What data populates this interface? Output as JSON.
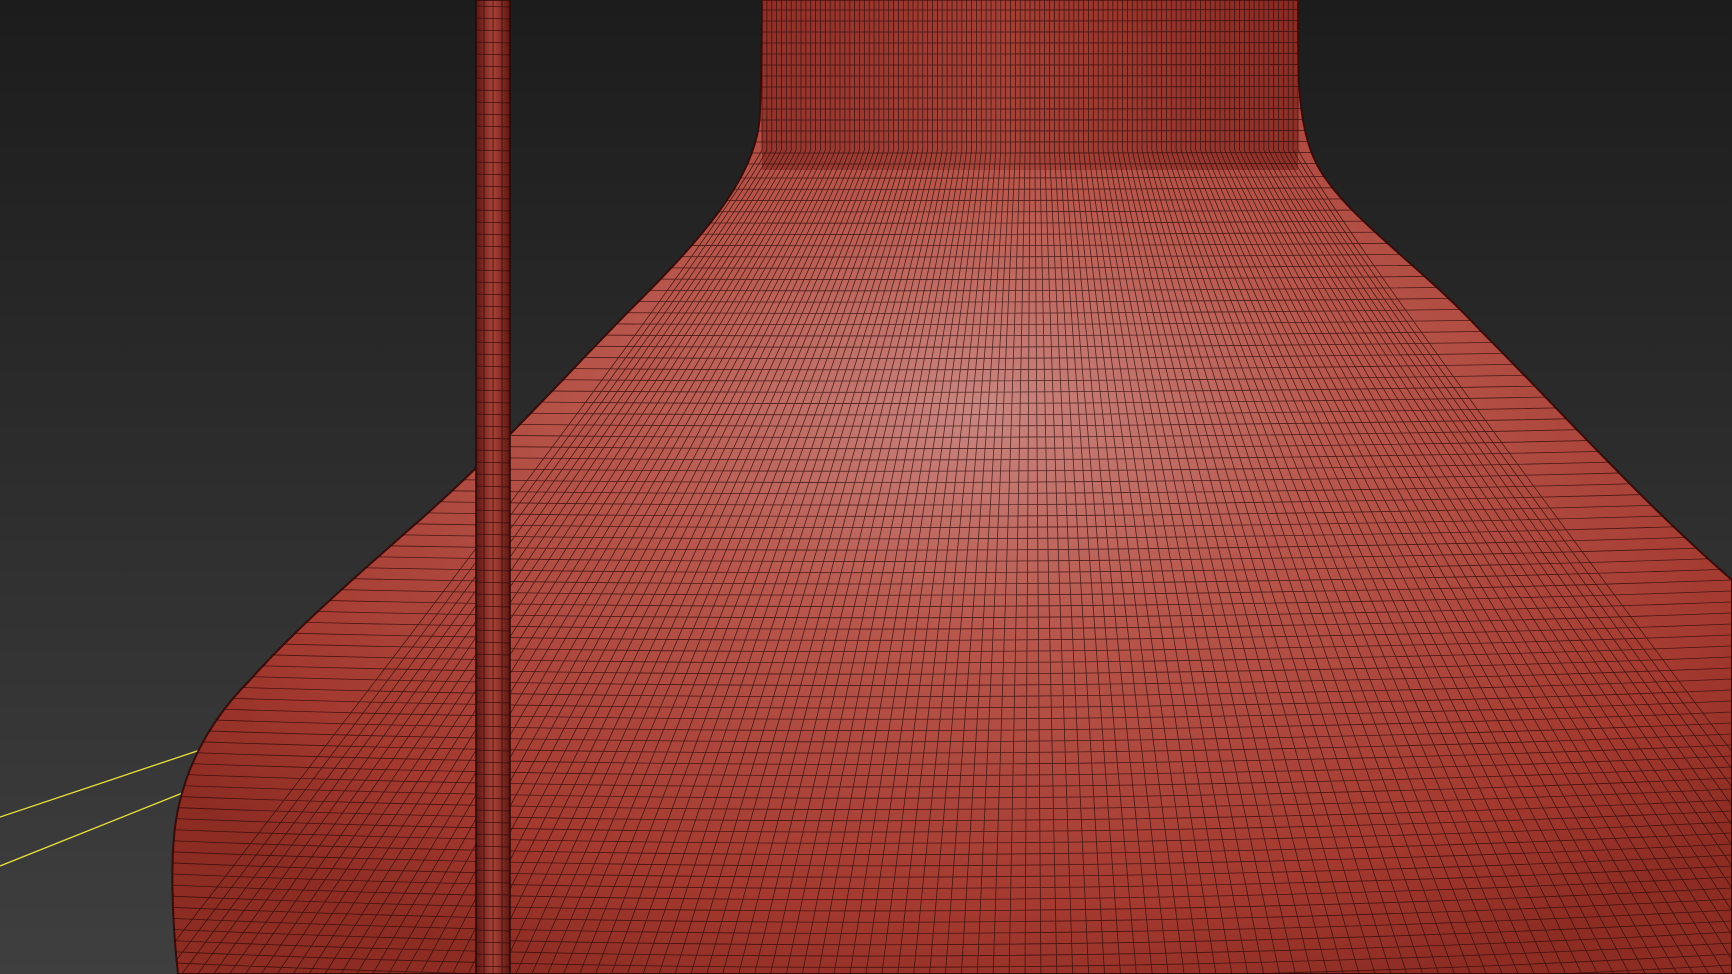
{
  "viewport": {
    "background_top": "#1c1c1c",
    "background_bottom": "#3f3f3f",
    "mesh_color": "#b04a40",
    "mesh_highlight": "#d08c86",
    "mesh_shadow": "#7a1f1a",
    "wire_color": "#2a0806",
    "guide_line_color": "#e8e23a"
  }
}
